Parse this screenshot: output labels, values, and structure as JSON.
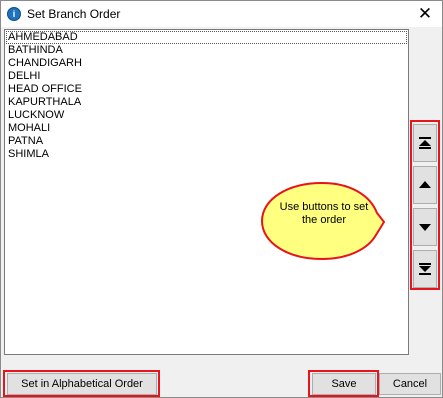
{
  "window": {
    "title": "Set Branch Order",
    "close_glyph": "✕",
    "app_icon": "info-icon"
  },
  "branch_list": {
    "items": [
      "AHMEDABAD",
      "BATHINDA",
      "CHANDIGARH",
      "DELHI",
      "HEAD OFFICE",
      "KAPURTHALA",
      "LUCKNOW",
      "MOHALI",
      "PATNA",
      "SHIMLA"
    ],
    "selected": "AHMEDABAD"
  },
  "order_buttons": [
    {
      "name": "move-to-top-button",
      "icon": "move-to-top-icon"
    },
    {
      "name": "move-up-button",
      "icon": "move-up-icon"
    },
    {
      "name": "move-down-button",
      "icon": "move-down-icon"
    },
    {
      "name": "move-to-bottom-button",
      "icon": "move-to-bottom-icon"
    }
  ],
  "callout": {
    "text": "Use buttons to set the order",
    "fill_color": "#ffff80",
    "border_color": "#e8141b"
  },
  "footer": {
    "alphabetical_label": "Set in Alphabetical Order",
    "save_label": "Save",
    "cancel_label": "Cancel"
  },
  "colors": {
    "highlight": "#e8141b"
  }
}
